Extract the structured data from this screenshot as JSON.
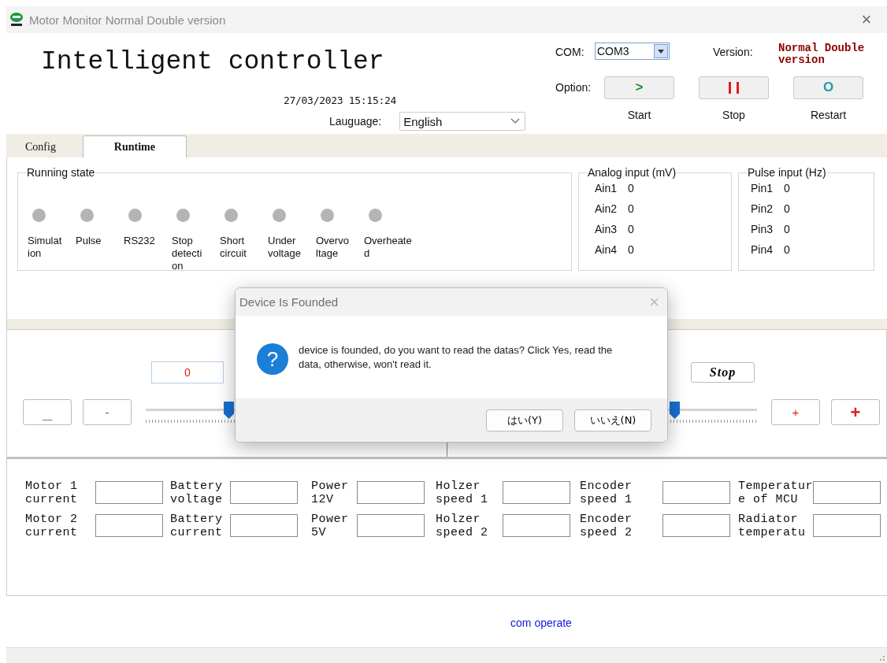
{
  "window": {
    "title": "Motor Monitor Normal Double version",
    "close": "×"
  },
  "header": {
    "title": "Intelligent controller",
    "datetime": "27/03/2023 15:15:24",
    "language": {
      "label": "Lauguage:",
      "value": "English"
    },
    "com": {
      "label": "COM:",
      "value": "COM3"
    },
    "version": {
      "label": "Version:",
      "value": "Normal Double version"
    },
    "option_label": "Option:",
    "options": [
      {
        "kind": "start",
        "symbol": ">",
        "label": "Start"
      },
      {
        "kind": "stop",
        "label": "Stop"
      },
      {
        "kind": "restart",
        "symbol": "O",
        "label": "Restart"
      }
    ]
  },
  "tabs": [
    {
      "label": "Config",
      "selected": false
    },
    {
      "label": "Runtime",
      "selected": true
    }
  ],
  "running_state": {
    "title": "Running state",
    "indicators": [
      {
        "label": "Simulation",
        "on": false
      },
      {
        "label": "Pulse",
        "on": false
      },
      {
        "label": "RS232",
        "on": false
      },
      {
        "label": "Stop detection",
        "on": false
      },
      {
        "label": "Short circuit",
        "on": false
      },
      {
        "label": "Under voltage",
        "on": false
      },
      {
        "label": "Overvoltage",
        "on": false
      },
      {
        "label": "Overheated",
        "on": false
      }
    ]
  },
  "analog_input": {
    "title": "Analog input (mV)",
    "channels": [
      {
        "name": "Ain1",
        "value": "0"
      },
      {
        "name": "Ain2",
        "value": "0"
      },
      {
        "name": "Ain3",
        "value": "0"
      },
      {
        "name": "Ain4",
        "value": "0"
      }
    ]
  },
  "pulse_input": {
    "title": "Pulse input (Hz)",
    "channels": [
      {
        "name": "Pin1",
        "value": "0"
      },
      {
        "name": "Pin2",
        "value": "0"
      },
      {
        "name": "Pin3",
        "value": "0"
      },
      {
        "name": "Pin4",
        "value": "0"
      }
    ]
  },
  "control": {
    "left": {
      "value": "0",
      "level": 0.5,
      "buttons": [
        {
          "kind": "big",
          "symbol": "_"
        },
        {
          "kind": "small",
          "symbol": "-"
        }
      ]
    },
    "right": {
      "button": "Stop",
      "level": 0.5,
      "buttons": [
        {
          "kind": "small",
          "symbol": "+"
        },
        {
          "kind": "big",
          "symbol": "+"
        }
      ]
    }
  },
  "readouts": [
    [
      {
        "label": "Motor 1 current"
      },
      {
        "label": "Battery voltage"
      },
      {
        "label": "Power 12V"
      },
      {
        "label": "Holzer speed 1"
      },
      {
        "label": "Encoder speed 1"
      },
      {
        "label": "Temperature of MCU"
      }
    ],
    [
      {
        "label": "Motor 2 current"
      },
      {
        "label": "Battery current"
      },
      {
        "label": "Power 5V"
      },
      {
        "label": "Holzer speed 2"
      },
      {
        "label": "Encoder speed 2"
      },
      {
        "label": "Radiator temperatu"
      }
    ]
  ],
  "link": "com operate",
  "dialog": {
    "title": "Device Is Founded",
    "close": "×",
    "icon": "?",
    "message": "device is founded, do you want to read the datas? Click Yes, read the data, otherwise, won't read it.",
    "buttons": [
      "はい(Y)",
      "いいえ(N)"
    ]
  }
}
